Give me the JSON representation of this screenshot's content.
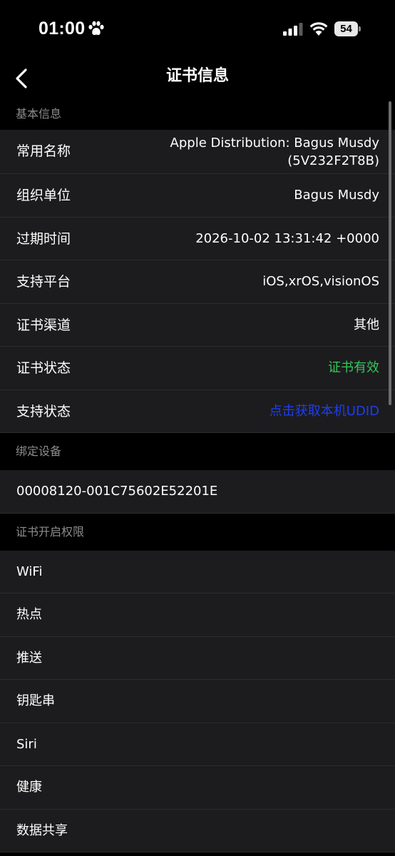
{
  "status_bar": {
    "time": "01:00",
    "battery": "54",
    "icons": [
      "paw-icon",
      "cellular-signal-icon",
      "wifi-icon",
      "battery-icon"
    ]
  },
  "nav": {
    "back_icon": "chevron-left-icon",
    "title": "证书信息"
  },
  "basic_info": {
    "header": "基本信息",
    "rows": [
      {
        "label": "常用名称",
        "value_line1": "Apple Distribution: Bagus Musdy",
        "value_line2": "(5V232F2T8B)"
      },
      {
        "label": "组织单位",
        "value": "Bagus Musdy"
      },
      {
        "label": "过期时间",
        "value": "2026-10-02 13:31:42 +0000"
      },
      {
        "label": "支持平台",
        "value": "iOS,xrOS,visionOS"
      },
      {
        "label": "证书渠道",
        "value": "其他"
      },
      {
        "label": "证书状态",
        "value": "证书有效"
      },
      {
        "label": "支持状态",
        "value": "点击获取本机UDID"
      }
    ],
    "colors": {
      "status_valid": "#34c759",
      "link": "#1f3df0"
    }
  },
  "bound_devices": {
    "header": "绑定设备",
    "udid": "00008120-001C75602E52201E"
  },
  "permissions": {
    "header": "证书开启权限",
    "items": [
      "WiFi",
      "热点",
      "推送",
      "钥匙串",
      "Siri",
      "健康",
      "数据共享"
    ]
  }
}
